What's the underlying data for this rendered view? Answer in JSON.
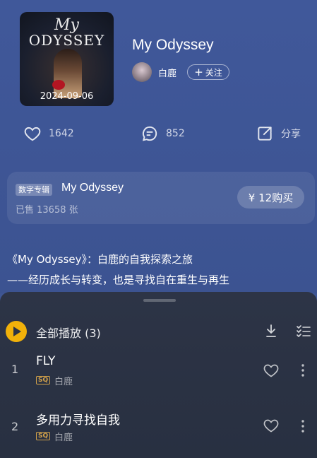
{
  "album": {
    "cover_text_line1": "My",
    "cover_text_line2": "ODYSSEY",
    "release_date": "2024-09-06",
    "title": "My Odyssey",
    "artist": "白鹿",
    "follow_label": "关注"
  },
  "actions": {
    "likes": "1642",
    "comments": "852",
    "share": "分享"
  },
  "purchase": {
    "tag": "数字专辑",
    "title": "My Odyssey",
    "sold": "已售 13658 张",
    "buy_label": "¥ 12购买"
  },
  "description": {
    "line1": "《My Odyssey》：白鹿的自我探索之旅",
    "line2": "——经历成长与转变，也是寻找自在重生与再生"
  },
  "tracklist": {
    "play_all_label": "全部播放 (3)",
    "tracks": [
      {
        "index": "1",
        "title": "FLY",
        "quality": "SQ",
        "artist": "白鹿"
      },
      {
        "index": "2",
        "title": "多用力寻找自我",
        "quality": "SQ",
        "artist": "白鹿"
      }
    ]
  },
  "colors": {
    "background": "#3f5694",
    "panel": "#2d3446",
    "accent": "#f1b10a",
    "quality_badge": "#d3a24a"
  },
  "icons": [
    "heart-icon",
    "comment-icon",
    "share-icon",
    "play-icon",
    "download-icon",
    "multi-select-icon",
    "more-icon"
  ]
}
